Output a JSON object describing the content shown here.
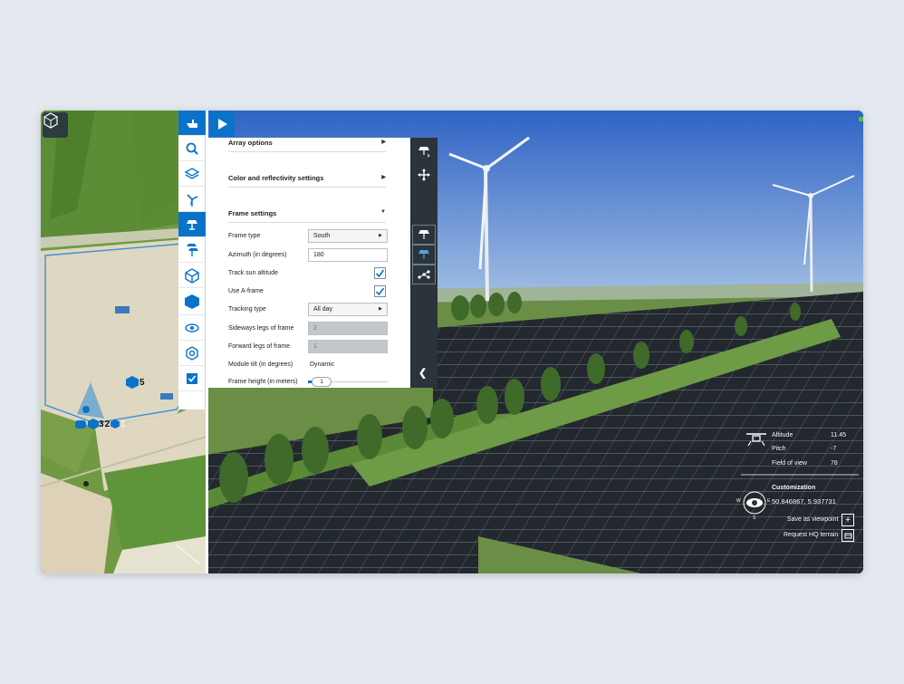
{
  "panel": {
    "sections": {
      "array_options": "Array options",
      "color_settings": "Color and reflectivity settings",
      "frame_settings": "Frame settings"
    },
    "fields": {
      "frame_type_label": "Frame type",
      "frame_type_value": "South",
      "azimuth_label": "Azimuth (in degrees)",
      "azimuth_value": "180",
      "track_sun_label": "Track sun altitude",
      "a_frame_label": "Use A-frame",
      "tracking_type_label": "Tracking type",
      "tracking_type_value": "All day",
      "sideways_label": "Sideways legs of frame",
      "sideways_value": "2",
      "forward_label": "Forward legs of frame",
      "forward_value": "1",
      "module_tilt_label": "Module tilt (in degrees)",
      "module_tilt_value": "Dynamic",
      "frame_height_label": "Frame height (in meters)",
      "frame_height_value": "1"
    }
  },
  "map_markers": {
    "marker_5": "5",
    "marker_3": "3",
    "marker_2": "2",
    "marker_1": "1"
  },
  "info": {
    "altitude_label": "Altitude",
    "altitude_value": "11.45",
    "pitch_label": "Pitch",
    "pitch_value": "-7",
    "fov_label": "Field of view",
    "fov_value": "78",
    "customization_label": "Customization",
    "coordinates": "50.846867, 5.937731",
    "save_viewpoint": "Save as viewpoint",
    "request_terrain": "Request HQ terrain",
    "compass_w": "W",
    "compass_e": "E",
    "compass_s": "S"
  },
  "colors": {
    "accent": "#0a73c9",
    "panel_dark": "#2b333b",
    "sky_top": "#2f63c4",
    "grass": "#5f8f3a"
  }
}
